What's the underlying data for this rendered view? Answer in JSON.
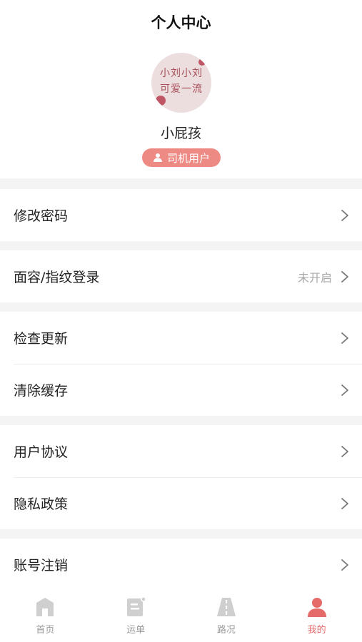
{
  "header": {
    "title": "个人中心",
    "avatar_text_line1": "小刘小刘",
    "avatar_text_line2": "可爱一流",
    "username": "小屁孩",
    "role_badge": "司机用户"
  },
  "menu": {
    "groups": [
      {
        "items": [
          {
            "label": "修改密码",
            "value": ""
          }
        ]
      },
      {
        "items": [
          {
            "label": "面容/指纹登录",
            "value": "未开启"
          }
        ]
      },
      {
        "items": [
          {
            "label": "检查更新",
            "value": ""
          },
          {
            "label": "清除缓存",
            "value": ""
          }
        ]
      },
      {
        "items": [
          {
            "label": "用户协议",
            "value": ""
          },
          {
            "label": "隐私政策",
            "value": ""
          }
        ]
      },
      {
        "items": [
          {
            "label": "账号注销",
            "value": ""
          }
        ]
      }
    ]
  },
  "tabbar": {
    "items": [
      {
        "label": "首页",
        "icon": "home-icon",
        "active": false
      },
      {
        "label": "运单",
        "icon": "waybill-icon",
        "active": false
      },
      {
        "label": "路况",
        "icon": "road-icon",
        "active": false
      },
      {
        "label": "我的",
        "icon": "profile-icon",
        "active": true
      }
    ]
  },
  "colors": {
    "accent": "#e56b6b",
    "badge": "#ee8a84",
    "inactive_tab": "#c8c8c8",
    "background": "#f4f4f4"
  }
}
